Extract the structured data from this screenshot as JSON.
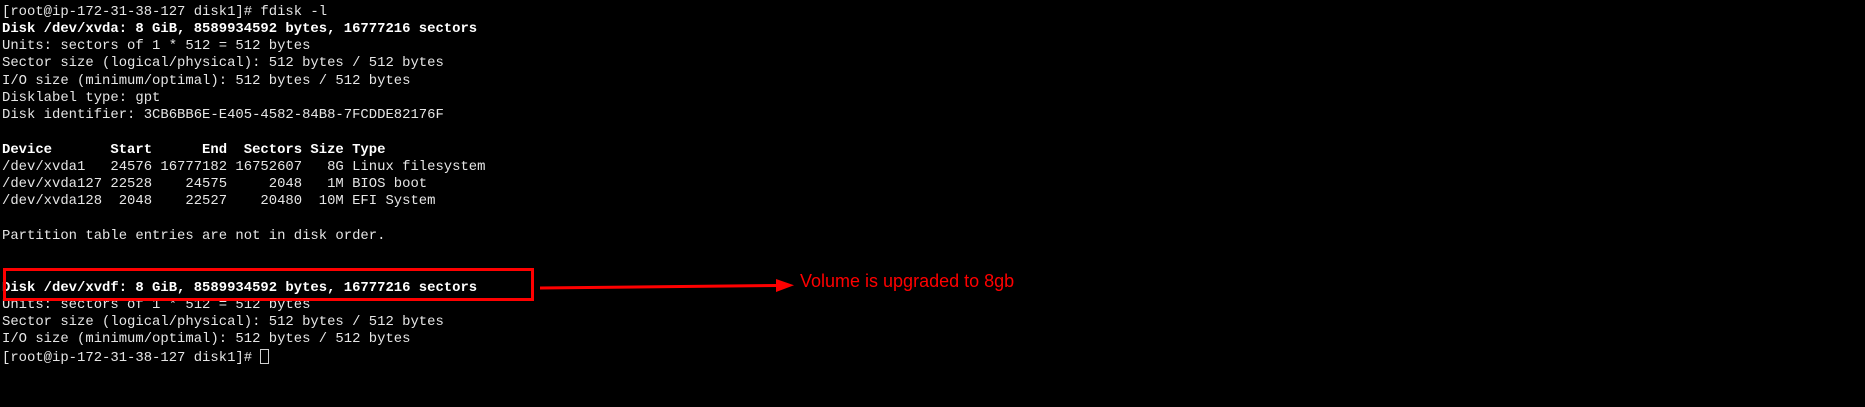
{
  "window": {
    "background": "#000000",
    "text_color": "#e6e6e6"
  },
  "terminal": {
    "lines": [
      {
        "text": "[root@ip-172-31-38-127 disk1]# fdisk -l",
        "bold": false
      },
      {
        "text": "Disk /dev/xvda: 8 GiB, 8589934592 bytes, 16777216 sectors",
        "bold": true
      },
      {
        "text": "Units: sectors of 1 * 512 = 512 bytes",
        "bold": false
      },
      {
        "text": "Sector size (logical/physical): 512 bytes / 512 bytes",
        "bold": false
      },
      {
        "text": "I/O size (minimum/optimal): 512 bytes / 512 bytes",
        "bold": false
      },
      {
        "text": "Disklabel type: gpt",
        "bold": false
      },
      {
        "text": "Disk identifier: 3CB6BB6E-E405-4582-84B8-7FCDDE82176F",
        "bold": false
      },
      {
        "text": "",
        "bold": false
      },
      {
        "text": "Device       Start      End  Sectors Size Type",
        "bold": true
      },
      {
        "text": "/dev/xvda1   24576 16777182 16752607   8G Linux filesystem",
        "bold": false
      },
      {
        "text": "/dev/xvda127 22528    24575     2048   1M BIOS boot",
        "bold": false
      },
      {
        "text": "/dev/xvda128  2048    22527    20480  10M EFI System",
        "bold": false
      },
      {
        "text": "",
        "bold": false
      },
      {
        "text": "Partition table entries are not in disk order.",
        "bold": false
      },
      {
        "text": "",
        "bold": false
      },
      {
        "text": "",
        "bold": false
      },
      {
        "text": "Disk /dev/xvdf: 8 GiB, 8589934592 bytes, 16777216 sectors",
        "bold": true
      },
      {
        "text": "Units: sectors of 1 * 512 = 512 bytes",
        "bold": false
      },
      {
        "text": "Sector size (logical/physical): 512 bytes / 512 bytes",
        "bold": false
      },
      {
        "text": "I/O size (minimum/optimal): 512 bytes / 512 bytes",
        "bold": false
      }
    ],
    "prompt": "[root@ip-172-31-38-127 disk1]# ",
    "cursor_icon": "block-cursor"
  },
  "annotation": {
    "text": "Volume is upgraded to 8gb",
    "color": "#ff0000"
  }
}
